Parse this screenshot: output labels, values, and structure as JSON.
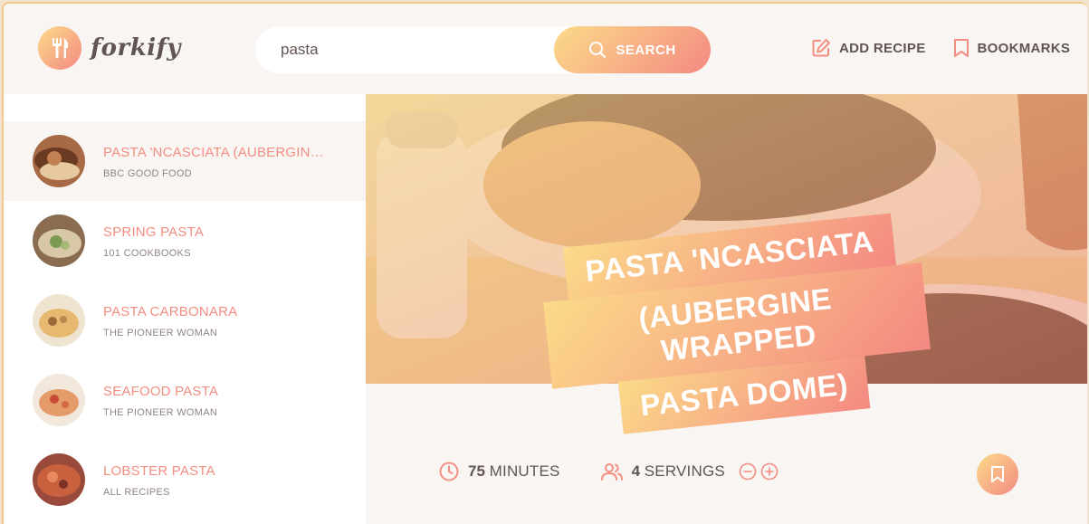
{
  "app": {
    "logo_text": "forkify"
  },
  "search": {
    "value": "pasta",
    "button_label": "SEARCH"
  },
  "nav": {
    "add_recipe_label": "ADD RECIPE",
    "bookmarks_label": "BOOKMARKS"
  },
  "results": [
    {
      "title": "PASTA 'NCASCIATA (AUBERGINE ...",
      "publisher": "BBC GOOD FOOD",
      "active": true
    },
    {
      "title": "SPRING PASTA",
      "publisher": "101 COOKBOOKS",
      "active": false
    },
    {
      "title": "PASTA CARBONARA",
      "publisher": "THE PIONEER WOMAN",
      "active": false
    },
    {
      "title": "SEAFOOD PASTA",
      "publisher": "THE PIONEER WOMAN",
      "active": false
    },
    {
      "title": "LOBSTER PASTA",
      "publisher": "ALL RECIPES",
      "active": false
    }
  ],
  "recipe": {
    "title_lines": [
      "PASTA 'NCASCIATA",
      "(AUBERGINE WRAPPED",
      "PASTA DOME)"
    ],
    "cooking_time": "75",
    "cooking_time_unit": "MINUTES",
    "servings": "4",
    "servings_unit": "SERVINGS"
  },
  "colors": {
    "accent_light": "#fbdb89",
    "accent_dark": "#f48982",
    "text": "#615551",
    "muted": "#918581",
    "bg": "#f9f5f3"
  },
  "icons": [
    "fork-knife-icon",
    "search-icon",
    "edit-icon",
    "bookmark-icon",
    "clock-icon",
    "users-icon",
    "minus-circle-icon",
    "plus-circle-icon"
  ]
}
